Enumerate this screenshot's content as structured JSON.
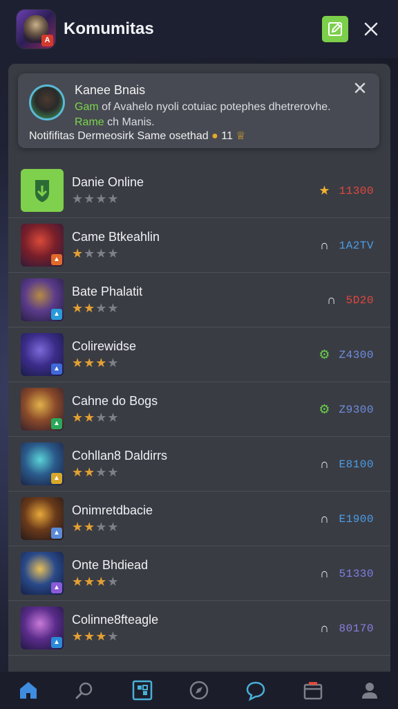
{
  "header": {
    "title": "Komumitas",
    "app_badge": "A",
    "edit_icon": "edit-icon",
    "close_icon": "close-icon"
  },
  "notification": {
    "title": "Kanee Bnais",
    "body_highlight": "Gam",
    "body_text": " of Avahelo nyoli cotuiac potephes dhetrerovhe.",
    "body_line2_highlight": "Rame",
    "body_line2": " ch Manis.",
    "footer": "Notififitas Dermeosirk Same osethad",
    "footer_count": "11",
    "close_icon": "close-icon"
  },
  "games": [
    {
      "name": "Danie Online",
      "rating": 3,
      "stars_filled": 0,
      "icon": "star-icon",
      "icon_color": "#f2b230",
      "value": "11300",
      "value_color": "#e2483c",
      "thumb": "shield"
    },
    {
      "name": "Came Btkeahlin",
      "rating": 3,
      "stars_filled": 1,
      "icon": "user-icon",
      "icon_color": "#e6e6e6",
      "value": "1A2TV",
      "value_color": "#4a9ee8",
      "thumb": "red"
    },
    {
      "name": "Bate Phalatit",
      "rating": 3,
      "stars_filled": 2,
      "icon": "user-icon",
      "icon_color": "#e6e6e6",
      "value": "5D20",
      "value_color": "#e2483c",
      "thumb": "purple"
    },
    {
      "name": "Colirewidse",
      "rating": 3,
      "stars_filled": 3,
      "icon": "gear-icon",
      "icon_color": "#6bd14a",
      "value": "Z4300",
      "value_color": "#6f8ee0",
      "thumb": "violet"
    },
    {
      "name": "Cahne do Bogs",
      "rating": 3,
      "stars_filled": 2,
      "icon": "gear-icon",
      "icon_color": "#6bd14a",
      "value": "Z9300",
      "value_color": "#6f8ee0",
      "thumb": "gold"
    },
    {
      "name": "Cohllan8 Daldirrs",
      "rating": 3,
      "stars_filled": 2,
      "icon": "user-icon",
      "icon_color": "#e6e6e6",
      "value": "E8100",
      "value_color": "#4a9ee8",
      "thumb": "teal"
    },
    {
      "name": "Onimretdbacie",
      "rating": 3,
      "stars_filled": 2,
      "icon": "user-icon",
      "icon_color": "#e6e6e6",
      "value": "E1900",
      "value_color": "#4a9ee8",
      "thumb": "bronze"
    },
    {
      "name": "Onte Bhdiead",
      "rating": 3,
      "stars_filled": 3,
      "icon": "user-icon",
      "icon_color": "#e6e6e6",
      "value": "51330",
      "value_color": "#7d7fe6",
      "thumb": "blue"
    },
    {
      "name": "Colinne8fteagle",
      "rating": 3,
      "stars_filled": 3,
      "icon": "user-icon",
      "icon_color": "#e6e6e6",
      "value": "80170",
      "value_color": "#8a7fe0",
      "thumb": "magenta"
    }
  ],
  "bottom_nav": [
    {
      "name": "home-icon",
      "active": true
    },
    {
      "name": "search-icon",
      "active": false
    },
    {
      "name": "games-icon",
      "active": false
    },
    {
      "name": "compass-icon",
      "active": false
    },
    {
      "name": "chat-icon",
      "active": false
    },
    {
      "name": "store-icon",
      "active": false
    },
    {
      "name": "profile-icon",
      "active": false
    }
  ],
  "colors": {
    "accent_green": "#7ccf4a",
    "accent_blue": "#3f8de0",
    "header_bg": "#1d2030",
    "panel_bg": "#3a3c44"
  }
}
